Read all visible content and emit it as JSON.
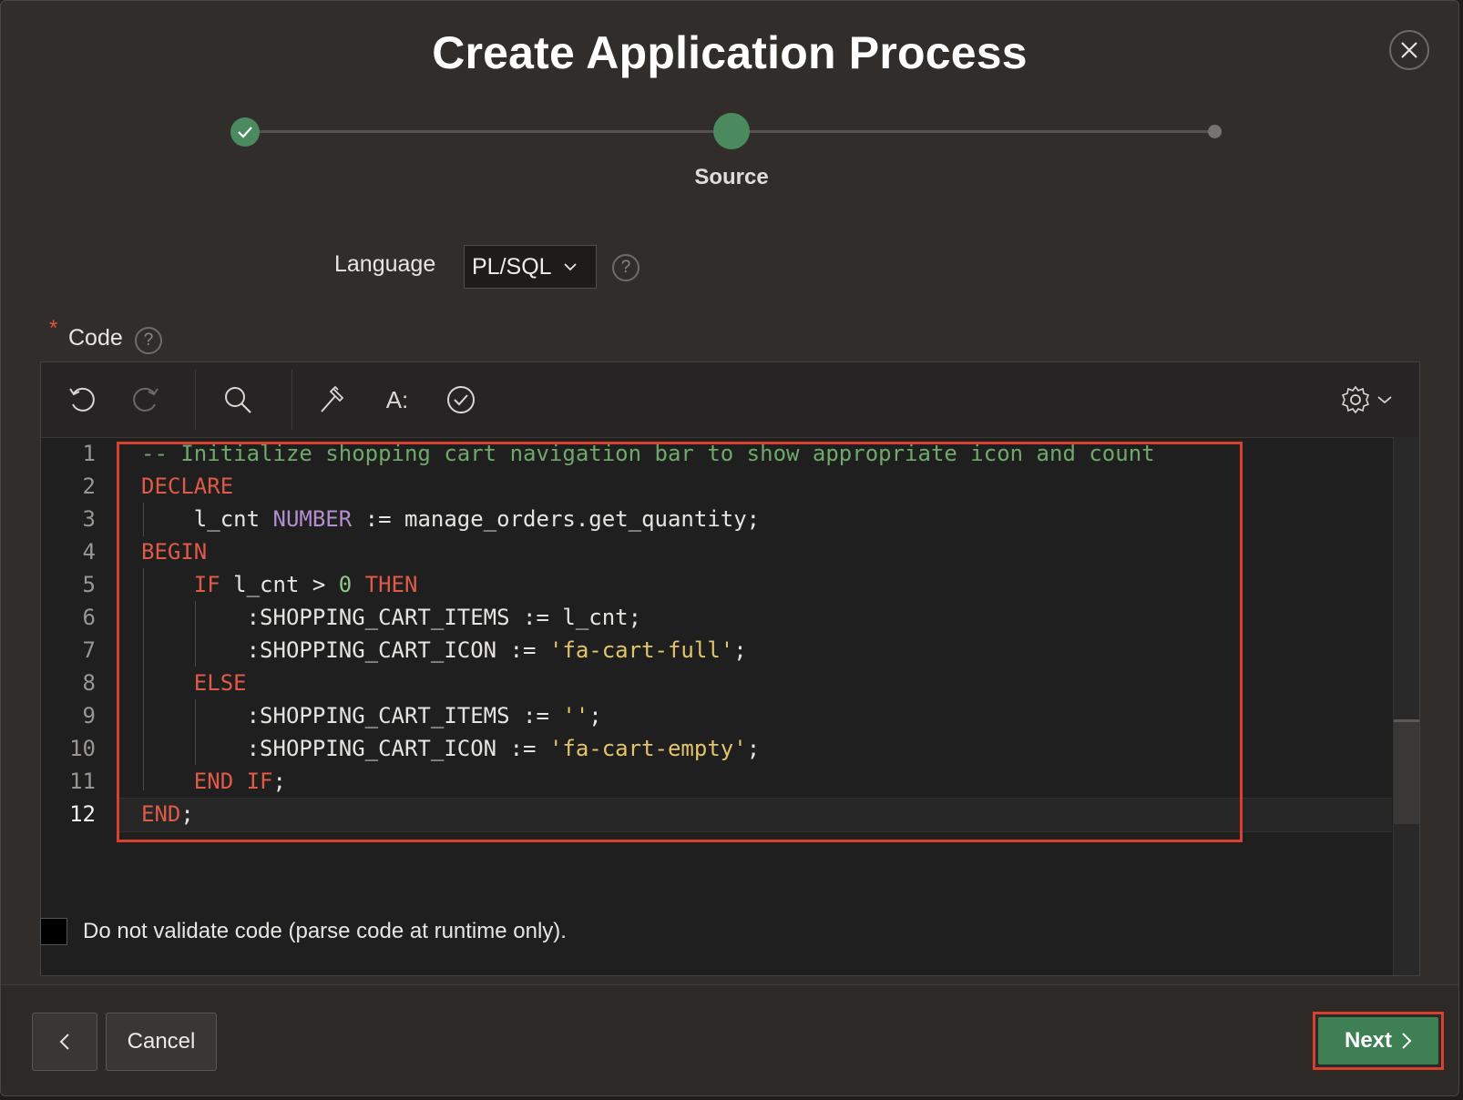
{
  "dialog": {
    "title": "Create Application Process",
    "close_icon": "close-icon"
  },
  "wizard": {
    "steps": [
      {
        "state": "complete",
        "label": ""
      },
      {
        "state": "current",
        "label": "Source"
      },
      {
        "state": "future",
        "label": ""
      }
    ],
    "current_label": "Source"
  },
  "form": {
    "language_label": "Language",
    "language_value": "PL/SQL",
    "code_label": "Code",
    "required_marker": "*",
    "help_text": "?"
  },
  "editor": {
    "toolbar": [
      "undo-icon",
      "redo-icon",
      "search-icon",
      "hammer-icon",
      "format-icon",
      "validate-icon",
      "gear-icon"
    ],
    "format_label": "A:",
    "active_line": 12,
    "lines": [
      {
        "n": "1",
        "tokens": [
          {
            "t": "-- Initialize shopping cart navigation bar to show appropriate icon and count",
            "c": "comment"
          }
        ]
      },
      {
        "n": "2",
        "tokens": [
          {
            "t": "DECLARE",
            "c": "kw"
          }
        ]
      },
      {
        "n": "3",
        "tokens": [
          {
            "t": "    l_cnt ",
            "c": ""
          },
          {
            "t": "NUMBER",
            "c": "type"
          },
          {
            "t": " := manage_orders.get_quantity;",
            "c": ""
          }
        ]
      },
      {
        "n": "4",
        "tokens": [
          {
            "t": "BEGIN",
            "c": "kw"
          }
        ]
      },
      {
        "n": "5",
        "tokens": [
          {
            "t": "    ",
            "c": ""
          },
          {
            "t": "IF",
            "c": "kw"
          },
          {
            "t": " l_cnt > ",
            "c": ""
          },
          {
            "t": "0",
            "c": "num"
          },
          {
            "t": " ",
            "c": ""
          },
          {
            "t": "THEN",
            "c": "kw"
          }
        ]
      },
      {
        "n": "6",
        "tokens": [
          {
            "t": "        :SHOPPING_CART_ITEMS := l_cnt;",
            "c": ""
          }
        ]
      },
      {
        "n": "7",
        "tokens": [
          {
            "t": "        :SHOPPING_CART_ICON := ",
            "c": ""
          },
          {
            "t": "'fa-cart-full'",
            "c": "str"
          },
          {
            "t": ";",
            "c": ""
          }
        ]
      },
      {
        "n": "8",
        "tokens": [
          {
            "t": "    ",
            "c": ""
          },
          {
            "t": "ELSE",
            "c": "kw"
          }
        ]
      },
      {
        "n": "9",
        "tokens": [
          {
            "t": "        :SHOPPING_CART_ITEMS := ",
            "c": ""
          },
          {
            "t": "''",
            "c": "str"
          },
          {
            "t": ";",
            "c": ""
          }
        ]
      },
      {
        "n": "10",
        "tokens": [
          {
            "t": "        :SHOPPING_CART_ICON := ",
            "c": ""
          },
          {
            "t": "'fa-cart-empty'",
            "c": "str"
          },
          {
            "t": ";",
            "c": ""
          }
        ]
      },
      {
        "n": "11",
        "tokens": [
          {
            "t": "    ",
            "c": ""
          },
          {
            "t": "END IF",
            "c": "kw"
          },
          {
            "t": ";",
            "c": ""
          }
        ]
      },
      {
        "n": "12",
        "tokens": [
          {
            "t": "END",
            "c": "kw"
          },
          {
            "t": ";",
            "c": ""
          }
        ]
      }
    ]
  },
  "options": {
    "no_validate_label": "Do not validate code (parse code at runtime only).",
    "no_validate_checked": false
  },
  "footer": {
    "cancel_label": "Cancel",
    "next_label": "Next"
  },
  "colors": {
    "accent_green": "#4b8a5f",
    "highlight_red": "#d9412e"
  }
}
